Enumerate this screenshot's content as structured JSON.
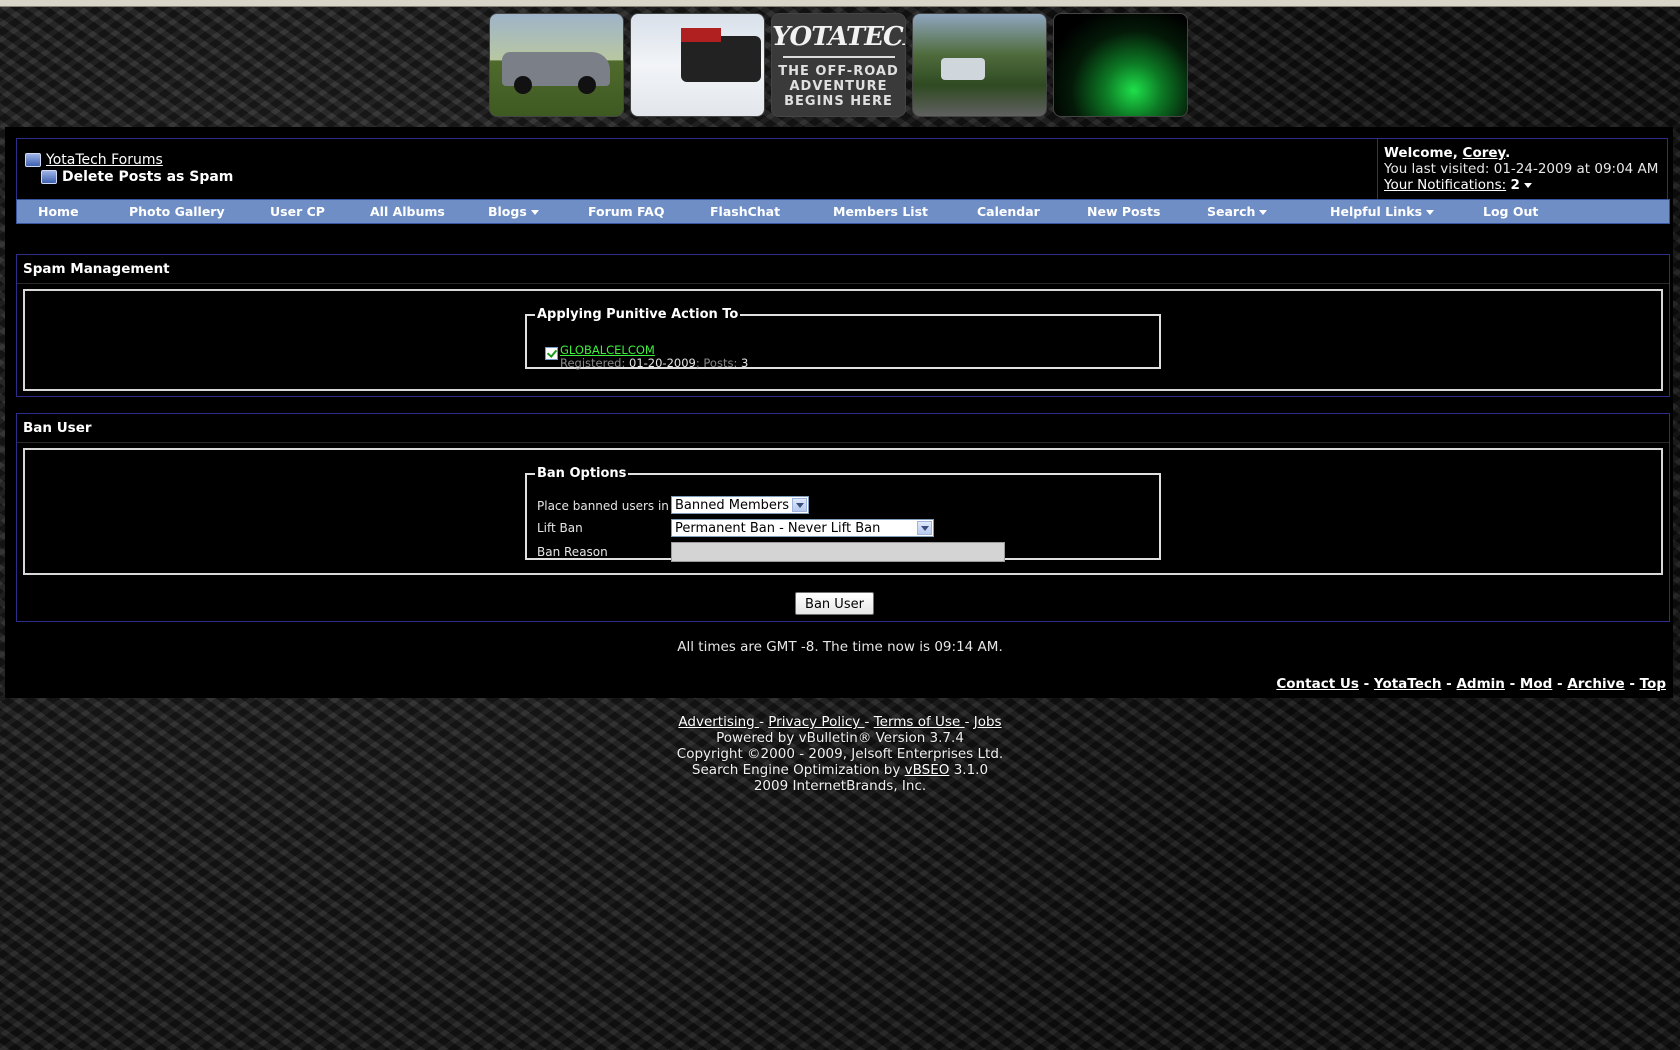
{
  "banner": {
    "logo_text": "YOTATECH",
    "tagline_1": "THE OFF-ROAD",
    "tagline_2": "ADVENTURE",
    "tagline_3": "BEGINS HERE"
  },
  "breadcrumb": {
    "forum_link": "YotaTech Forums",
    "current_page": "Delete Posts as Spam"
  },
  "welcome": {
    "greeting": "Welcome, ",
    "username": "Corey",
    "period": ".",
    "last_visited_prefix": "You last visited: ",
    "last_visited_date": "01-24-2009",
    "last_visited_at": " at ",
    "last_visited_time": "09:04 AM",
    "notifications_label": "Your Notifications:",
    "notifications_count": "2"
  },
  "menu": [
    {
      "label": "Home",
      "dropdown": false
    },
    {
      "label": "Photo Gallery",
      "dropdown": false
    },
    {
      "label": "User CP",
      "dropdown": false
    },
    {
      "label": "All Albums",
      "dropdown": false
    },
    {
      "label": "Blogs",
      "dropdown": true
    },
    {
      "label": "Forum FAQ",
      "dropdown": false
    },
    {
      "label": "FlashChat",
      "dropdown": false
    },
    {
      "label": "Members List",
      "dropdown": false
    },
    {
      "label": "Calendar",
      "dropdown": false
    },
    {
      "label": "New Posts",
      "dropdown": false
    },
    {
      "label": "Search",
      "dropdown": true
    },
    {
      "label": "Helpful Links",
      "dropdown": true
    },
    {
      "label": "Log Out",
      "dropdown": false
    }
  ],
  "spam": {
    "title": "Spam Management",
    "fieldset_legend": "Applying Punitive Action To",
    "user_name": "GLOBALCELCOM",
    "registered_label": "Registered:",
    "registered_date": "01-20-2009",
    "posts_label": "Posts:",
    "posts_count": "3",
    "checked": true
  },
  "ban": {
    "title": "Ban User",
    "fieldset_legend": "Ban Options",
    "group_label": "Place banned users in to",
    "group_value": "Banned Members",
    "lift_label": "Lift Ban",
    "lift_value": "Permanent Ban - Never Lift Ban",
    "reason_label": "Ban Reason",
    "reason_value": "",
    "submit_label": "Ban User"
  },
  "timezone": {
    "prefix": "All times are GMT -8. The time now is ",
    "time": "09:14 AM",
    "suffix": "."
  },
  "footer_links": [
    "Contact Us",
    "YotaTech",
    "Admin",
    "Mod",
    "Archive",
    "Top"
  ],
  "copyright": {
    "link_advertising": "Advertising ",
    "link_privacy": "Privacy Policy ",
    "link_terms": "Terms of Use ",
    "link_jobs": "Jobs",
    "powered_by": "Powered by vBulletin® Version 3.7.4",
    "copyright_line": "Copyright ©2000 - 2009, Jelsoft Enterprises Ltd.",
    "seo_prefix": "Search Engine Optimization by ",
    "seo_link": "vBSEO",
    "seo_version": " 3.1.0",
    "company_line": "2009 InternetBrands, Inc."
  }
}
